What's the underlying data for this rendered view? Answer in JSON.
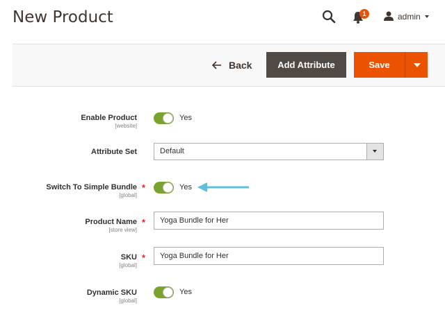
{
  "header": {
    "title": "New Product",
    "notification_count": "1",
    "user_name": "admin",
    "icons": {
      "search": "search-icon",
      "notifications": "bell-icon",
      "user": "user-icon"
    }
  },
  "actions": {
    "back_label": "Back",
    "add_attribute_label": "Add Attribute",
    "save_label": "Save"
  },
  "form": {
    "enable_product": {
      "label": "Enable Product",
      "scope": "[website]",
      "value": "Yes"
    },
    "attribute_set": {
      "label": "Attribute Set",
      "value": "Default"
    },
    "switch_bundle": {
      "label": "Switch To Simple Bundle",
      "scope": "[global]",
      "value": "Yes",
      "required": "*"
    },
    "product_name": {
      "label": "Product Name",
      "scope": "[store view]",
      "value": "Yoga Bundle for Her",
      "required": "*"
    },
    "sku": {
      "label": "SKU",
      "scope": "[global]",
      "value": "Yoga Bundle for Her",
      "required": "*"
    },
    "dynamic_sku": {
      "label": "Dynamic SKU",
      "scope": "[global]",
      "value": "Yes"
    }
  },
  "colors": {
    "accent": "#eb5202",
    "toggle_on": "#79a22e",
    "dark_button": "#514943",
    "annotation_arrow": "#5bc0de"
  }
}
